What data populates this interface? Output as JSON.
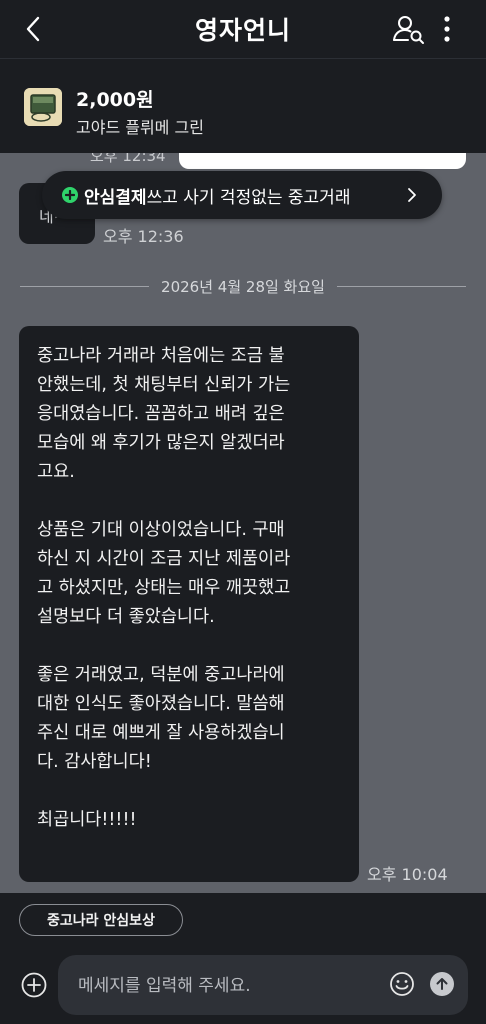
{
  "header": {
    "title": "영자언니"
  },
  "product": {
    "price": "2,000원",
    "name": "고야드 플뤼메 그린"
  },
  "previous": {
    "right_time": "오후 12:34",
    "left_text": "네~",
    "left_time": "오후 12:36"
  },
  "safe_banner": {
    "bold": "안심결제",
    "rest": "쓰고 사기 걱정없는 중고거래"
  },
  "date_divider": "2026년 4월 28일 화요일",
  "message": {
    "paragraphs": [
      "중고나라 거래라 처음에는 조금 불\n안했는데, 첫 채팅부터 신뢰가 가는\n응대였습니다. 꼼꼼하고 배려 깊은\n모습에 왜 후기가 많은지 알겠더라\n고요.",
      "상품은 기대 이상이었습니다. 구매\n하신 지 시간이 조금 지난 제품이라\n고 하셨지만, 상태는 매우 깨끗했고\n설명보다 더 좋았습니다.",
      "좋은 거래였고, 덕분에 중고나라에\n대한 인식도 좋아졌습니다. 말씀해\n주신 대로 예쁘게 잘 사용하겠습니\n다. 감사합니다!",
      "최곱니다!!!!!"
    ],
    "time": "오후 10:04"
  },
  "bottom": {
    "chip": "중고나라 안심보상",
    "input_placeholder": "메세지를 입력해 주세요."
  },
  "icons": [
    "back-icon",
    "user-search-icon",
    "more-vertical-icon",
    "plus-circle-icon",
    "chevron-right-icon",
    "add-circle-icon",
    "emoji-icon",
    "send-icon"
  ],
  "colors": {
    "accent_green": "#2fd36b",
    "bubble_dark": "#1b1d21",
    "chat_bg": "#5f6269"
  }
}
